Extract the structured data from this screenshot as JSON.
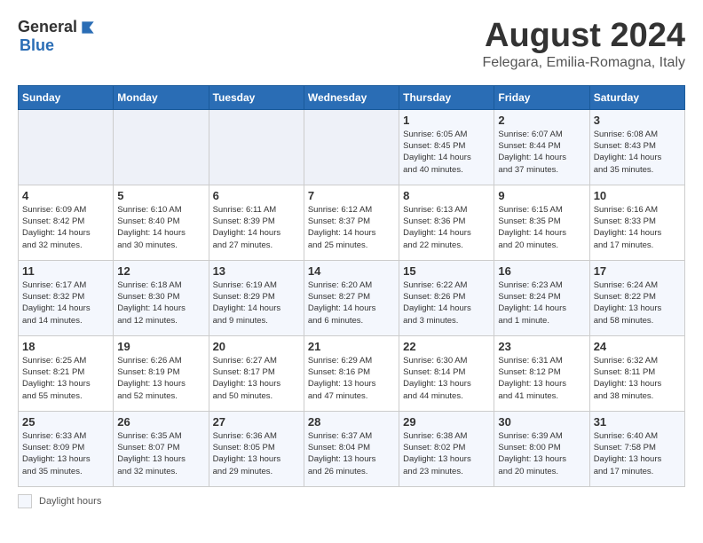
{
  "header": {
    "logo_general": "General",
    "logo_blue": "Blue",
    "month_title": "August 2024",
    "location": "Felegara, Emilia-Romagna, Italy"
  },
  "weekdays": [
    "Sunday",
    "Monday",
    "Tuesday",
    "Wednesday",
    "Thursday",
    "Friday",
    "Saturday"
  ],
  "weeks": [
    [
      {
        "day": "",
        "info": ""
      },
      {
        "day": "",
        "info": ""
      },
      {
        "day": "",
        "info": ""
      },
      {
        "day": "",
        "info": ""
      },
      {
        "day": "1",
        "info": "Sunrise: 6:05 AM\nSunset: 8:45 PM\nDaylight: 14 hours\nand 40 minutes."
      },
      {
        "day": "2",
        "info": "Sunrise: 6:07 AM\nSunset: 8:44 PM\nDaylight: 14 hours\nand 37 minutes."
      },
      {
        "day": "3",
        "info": "Sunrise: 6:08 AM\nSunset: 8:43 PM\nDaylight: 14 hours\nand 35 minutes."
      }
    ],
    [
      {
        "day": "4",
        "info": "Sunrise: 6:09 AM\nSunset: 8:42 PM\nDaylight: 14 hours\nand 32 minutes."
      },
      {
        "day": "5",
        "info": "Sunrise: 6:10 AM\nSunset: 8:40 PM\nDaylight: 14 hours\nand 30 minutes."
      },
      {
        "day": "6",
        "info": "Sunrise: 6:11 AM\nSunset: 8:39 PM\nDaylight: 14 hours\nand 27 minutes."
      },
      {
        "day": "7",
        "info": "Sunrise: 6:12 AM\nSunset: 8:37 PM\nDaylight: 14 hours\nand 25 minutes."
      },
      {
        "day": "8",
        "info": "Sunrise: 6:13 AM\nSunset: 8:36 PM\nDaylight: 14 hours\nand 22 minutes."
      },
      {
        "day": "9",
        "info": "Sunrise: 6:15 AM\nSunset: 8:35 PM\nDaylight: 14 hours\nand 20 minutes."
      },
      {
        "day": "10",
        "info": "Sunrise: 6:16 AM\nSunset: 8:33 PM\nDaylight: 14 hours\nand 17 minutes."
      }
    ],
    [
      {
        "day": "11",
        "info": "Sunrise: 6:17 AM\nSunset: 8:32 PM\nDaylight: 14 hours\nand 14 minutes."
      },
      {
        "day": "12",
        "info": "Sunrise: 6:18 AM\nSunset: 8:30 PM\nDaylight: 14 hours\nand 12 minutes."
      },
      {
        "day": "13",
        "info": "Sunrise: 6:19 AM\nSunset: 8:29 PM\nDaylight: 14 hours\nand 9 minutes."
      },
      {
        "day": "14",
        "info": "Sunrise: 6:20 AM\nSunset: 8:27 PM\nDaylight: 14 hours\nand 6 minutes."
      },
      {
        "day": "15",
        "info": "Sunrise: 6:22 AM\nSunset: 8:26 PM\nDaylight: 14 hours\nand 3 minutes."
      },
      {
        "day": "16",
        "info": "Sunrise: 6:23 AM\nSunset: 8:24 PM\nDaylight: 14 hours\nand 1 minute."
      },
      {
        "day": "17",
        "info": "Sunrise: 6:24 AM\nSunset: 8:22 PM\nDaylight: 13 hours\nand 58 minutes."
      }
    ],
    [
      {
        "day": "18",
        "info": "Sunrise: 6:25 AM\nSunset: 8:21 PM\nDaylight: 13 hours\nand 55 minutes."
      },
      {
        "day": "19",
        "info": "Sunrise: 6:26 AM\nSunset: 8:19 PM\nDaylight: 13 hours\nand 52 minutes."
      },
      {
        "day": "20",
        "info": "Sunrise: 6:27 AM\nSunset: 8:17 PM\nDaylight: 13 hours\nand 50 minutes."
      },
      {
        "day": "21",
        "info": "Sunrise: 6:29 AM\nSunset: 8:16 PM\nDaylight: 13 hours\nand 47 minutes."
      },
      {
        "day": "22",
        "info": "Sunrise: 6:30 AM\nSunset: 8:14 PM\nDaylight: 13 hours\nand 44 minutes."
      },
      {
        "day": "23",
        "info": "Sunrise: 6:31 AM\nSunset: 8:12 PM\nDaylight: 13 hours\nand 41 minutes."
      },
      {
        "day": "24",
        "info": "Sunrise: 6:32 AM\nSunset: 8:11 PM\nDaylight: 13 hours\nand 38 minutes."
      }
    ],
    [
      {
        "day": "25",
        "info": "Sunrise: 6:33 AM\nSunset: 8:09 PM\nDaylight: 13 hours\nand 35 minutes."
      },
      {
        "day": "26",
        "info": "Sunrise: 6:35 AM\nSunset: 8:07 PM\nDaylight: 13 hours\nand 32 minutes."
      },
      {
        "day": "27",
        "info": "Sunrise: 6:36 AM\nSunset: 8:05 PM\nDaylight: 13 hours\nand 29 minutes."
      },
      {
        "day": "28",
        "info": "Sunrise: 6:37 AM\nSunset: 8:04 PM\nDaylight: 13 hours\nand 26 minutes."
      },
      {
        "day": "29",
        "info": "Sunrise: 6:38 AM\nSunset: 8:02 PM\nDaylight: 13 hours\nand 23 minutes."
      },
      {
        "day": "30",
        "info": "Sunrise: 6:39 AM\nSunset: 8:00 PM\nDaylight: 13 hours\nand 20 minutes."
      },
      {
        "day": "31",
        "info": "Sunrise: 6:40 AM\nSunset: 7:58 PM\nDaylight: 13 hours\nand 17 minutes."
      }
    ]
  ],
  "legend": {
    "daylight_label": "Daylight hours"
  }
}
